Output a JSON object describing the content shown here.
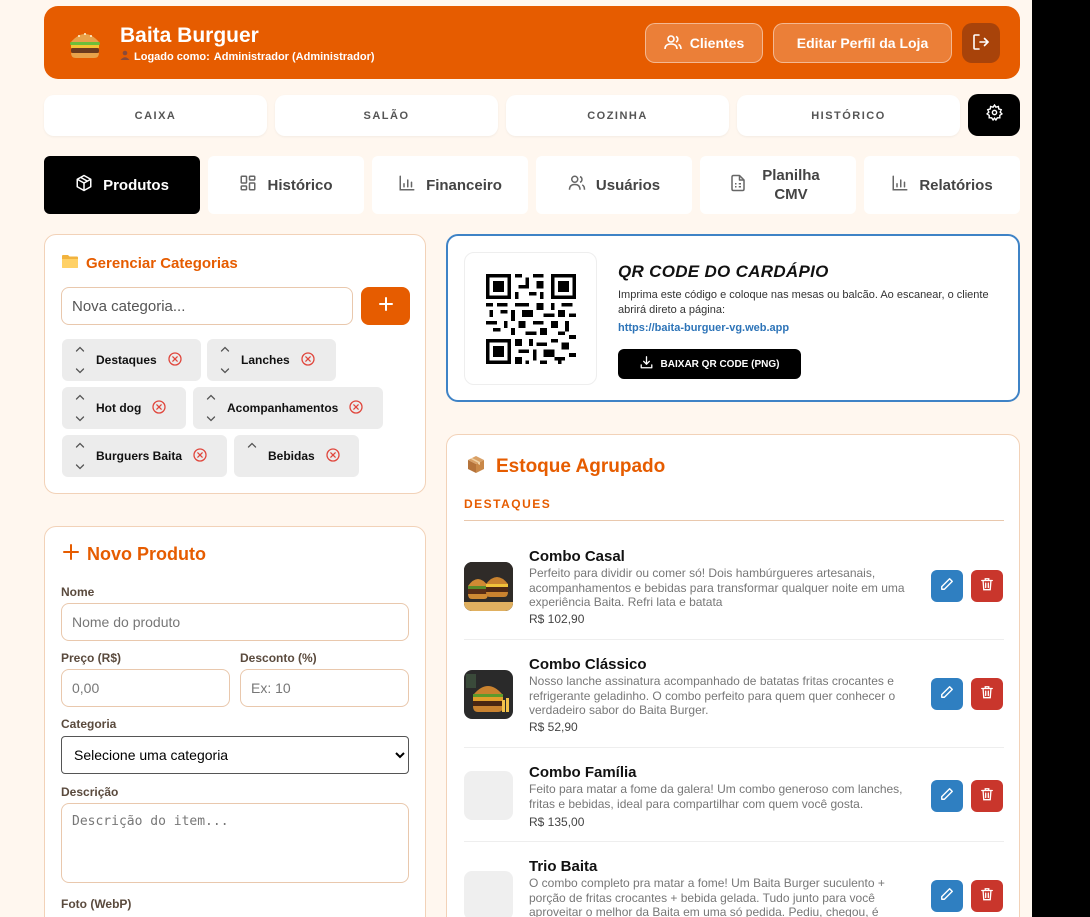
{
  "header": {
    "store_name": "Baita Burguer",
    "logged_prefix": "Logado como:",
    "logged_user": "Administrador (Administrador)",
    "clientes_label": "Clientes",
    "edit_profile_label": "Editar Perfil da Loja"
  },
  "top_nav": [
    "CAIXA",
    "SALÃO",
    "COZINHA",
    "HISTÓRICO"
  ],
  "sub_nav": {
    "produtos": "Produtos",
    "historico": "Histórico",
    "financeiro": "Financeiro",
    "usuarios": "Usuários",
    "planilha": "Planilha CMV",
    "relatorios": "Relatórios"
  },
  "categories": {
    "title": "Gerenciar Categorias",
    "input_placeholder": "Nova categoria...",
    "items": [
      "Destaques",
      "Lanches",
      "Hot dog",
      "Acompanhamentos",
      "Burguers Baita",
      "Bebidas"
    ]
  },
  "new_product": {
    "title": "Novo Produto",
    "name_label": "Nome",
    "name_placeholder": "Nome do produto",
    "price_label": "Preço (R$)",
    "price_placeholder": "0,00",
    "discount_label": "Desconto (%)",
    "discount_placeholder": "Ex: 10",
    "category_label": "Categoria",
    "category_selected": "Selecione uma categoria",
    "description_label": "Descrição",
    "description_placeholder": "Descrição do item...",
    "photo_label": "Foto (WebP)"
  },
  "qr": {
    "title": "QR CODE DO CARDÁPIO",
    "description": "Imprima este código e coloque nas mesas ou balcão. Ao escanear, o cliente abrirá direto a página:",
    "url": "https://baita-burguer-vg.web.app",
    "button_label": "BAIXAR QR CODE (PNG)"
  },
  "stock": {
    "title": "Estoque Agrupado",
    "section": "DESTAQUES",
    "products": [
      {
        "name": "Combo Casal",
        "description": "Perfeito para dividir ou comer só! Dois hambúrgueres artesanais, acompanhamentos e bebidas para transformar qualquer noite em uma experiência Baita. Refri lata e batata",
        "price": "R$ 102,90",
        "has_image": true
      },
      {
        "name": "Combo Clássico",
        "description": "Nosso lanche assinatura acompanhado de batatas fritas crocantes e refrigerante geladinho. O combo perfeito para quem quer conhecer o verdadeiro sabor do Baita Burger.",
        "price": "R$ 52,90",
        "has_image": true
      },
      {
        "name": "Combo Família",
        "description": "Feito para matar a fome da galera! Um combo generoso com lanches, fritas e bebidas, ideal para compartilhar com quem você gosta.",
        "price": "R$ 135,00",
        "has_image": false
      },
      {
        "name": "Trio Baita",
        "description": "O combo completo pra matar a fome! Um Baita Burger suculento + porção de fritas crocantes + bebida gelada. Tudo junto para você aproveitar o melhor da Baita em uma só pedida. Pediu, chegou, é Baita!",
        "price": "",
        "has_image": false
      }
    ]
  },
  "colors": {
    "accent": "#e65c00",
    "edit": "#2f7fc1",
    "delete": "#c9362c",
    "qr_border": "#3f83c6"
  }
}
